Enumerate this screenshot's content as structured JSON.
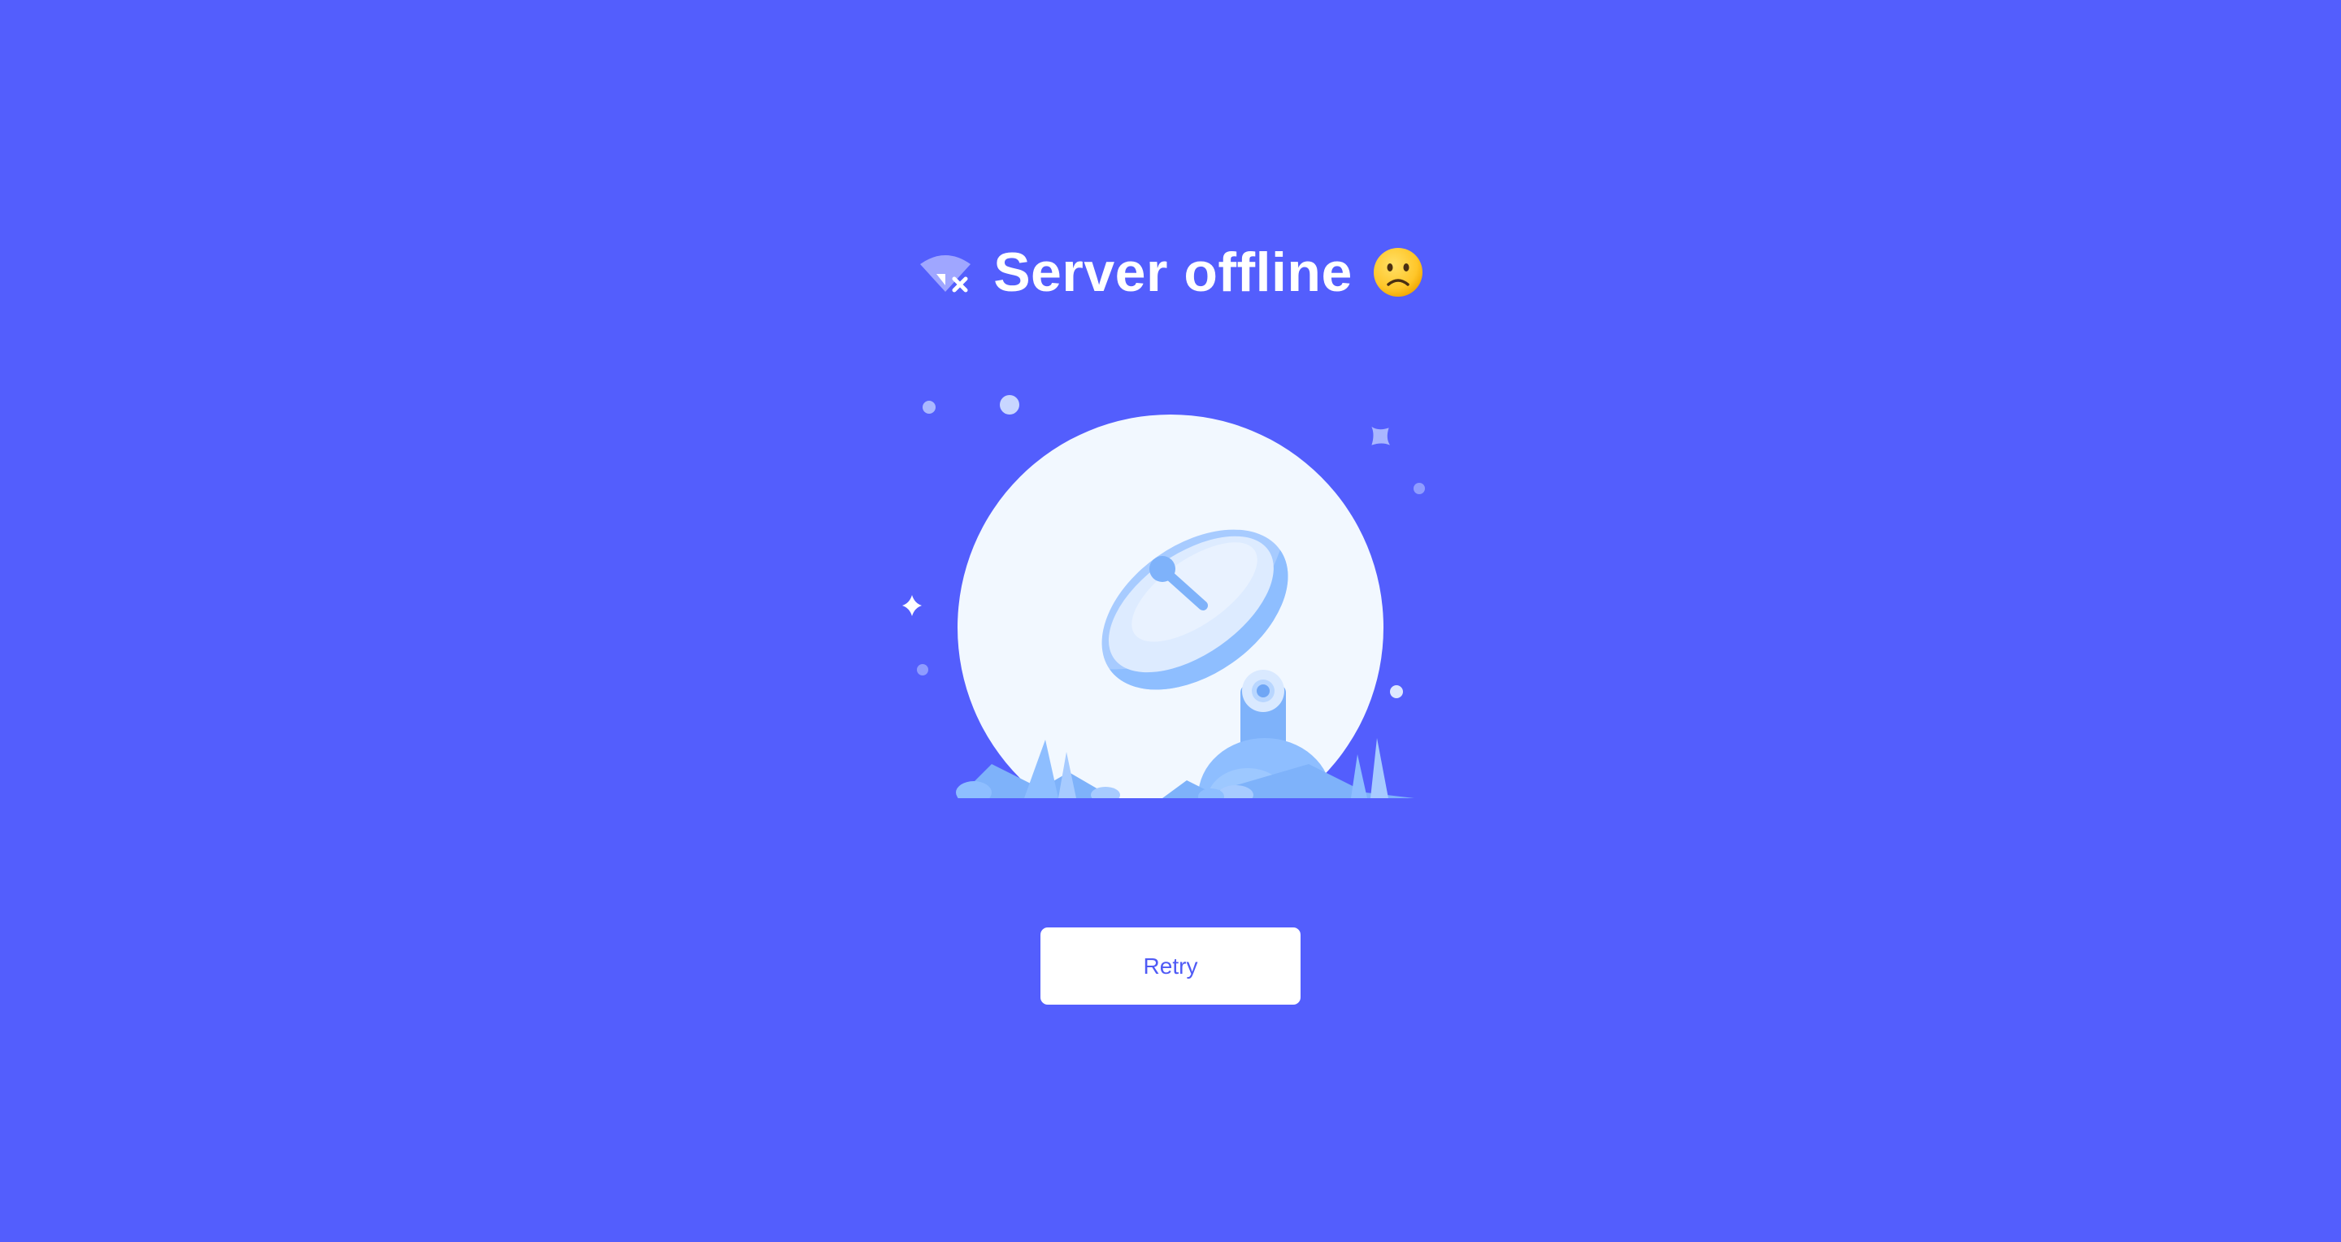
{
  "header": {
    "title": "Server offline",
    "status_icon": "wifi-off-icon",
    "mood_icon": "slightly-frowning-face-icon"
  },
  "illustration": {
    "icon": "satellite-dish-icon"
  },
  "actions": {
    "retry_label": "Retry"
  },
  "colors": {
    "background": "#535EFD",
    "button_background": "#FFFFFF",
    "button_text": "#4F5AF5",
    "title_text": "#FFFFFF",
    "moon": "#F2F8FF",
    "dish_light": "#A7CBFF",
    "dish_mid": "#8EBEFF",
    "dish_dark": "#6FA6F5"
  }
}
